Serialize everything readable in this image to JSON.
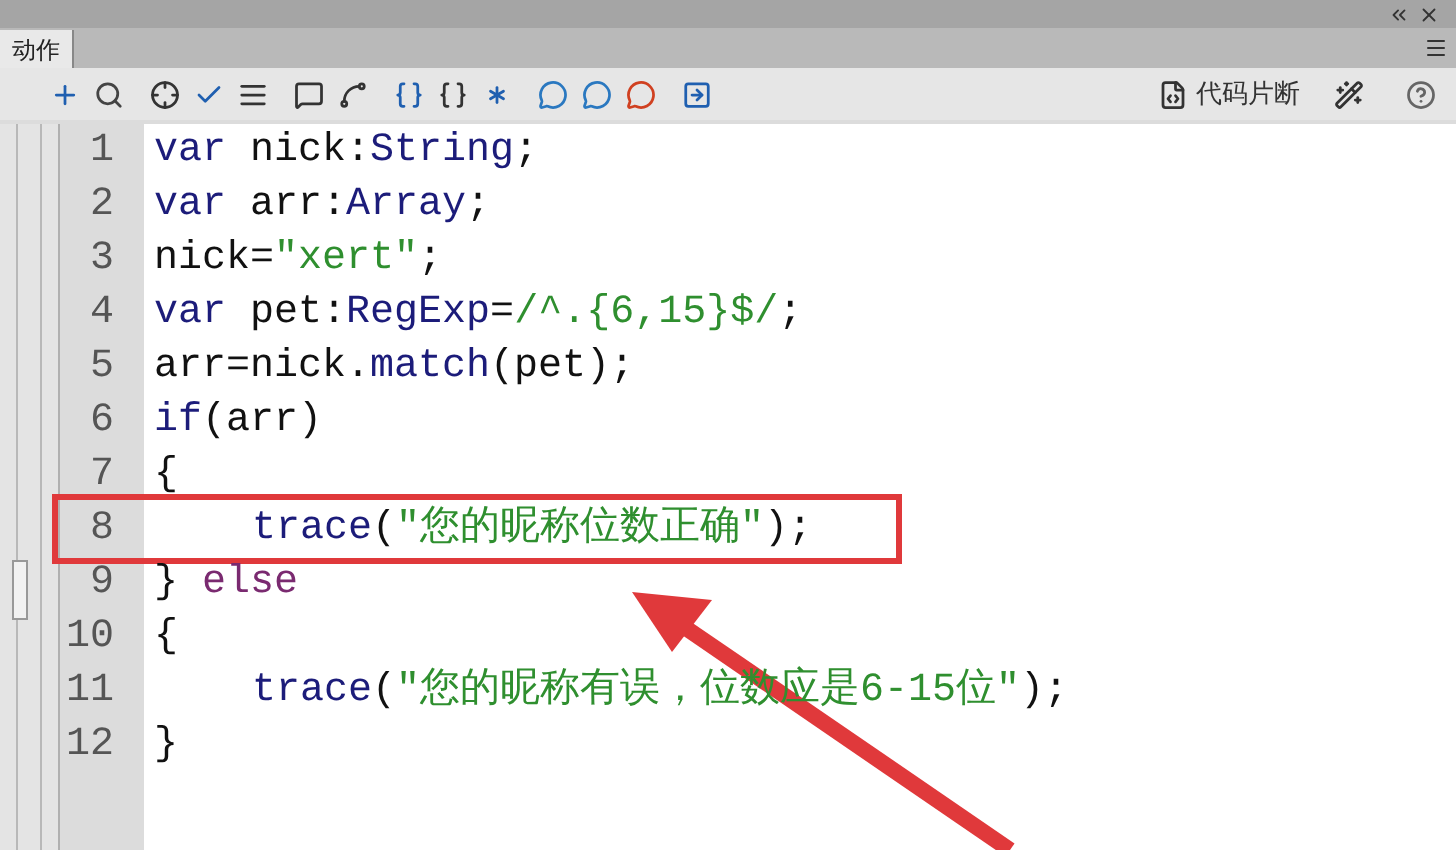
{
  "panel": {
    "tab": {
      "label": "动作",
      "selected": true
    },
    "toolbar": {
      "snippets_label": "代码片断"
    },
    "code_lines": [
      {
        "number": "1",
        "highlighted": false,
        "tokens": [
          {
            "kind": "keyword",
            "text": "var"
          },
          {
            "kind": "plain",
            "text": " nick:"
          },
          {
            "kind": "keyword",
            "text": "String"
          },
          {
            "kind": "plain",
            "text": ";"
          }
        ]
      },
      {
        "number": "2",
        "highlighted": false,
        "tokens": [
          {
            "kind": "keyword",
            "text": "var"
          },
          {
            "kind": "plain",
            "text": " arr:"
          },
          {
            "kind": "keyword",
            "text": "Array"
          },
          {
            "kind": "plain",
            "text": ";"
          }
        ]
      },
      {
        "number": "3",
        "highlighted": false,
        "tokens": [
          {
            "kind": "plain",
            "text": "nick="
          },
          {
            "kind": "string",
            "text": "\"xert\""
          },
          {
            "kind": "plain",
            "text": ";"
          }
        ]
      },
      {
        "number": "4",
        "highlighted": false,
        "tokens": [
          {
            "kind": "keyword",
            "text": "var"
          },
          {
            "kind": "plain",
            "text": " pet:"
          },
          {
            "kind": "keyword",
            "text": "RegExp"
          },
          {
            "kind": "plain",
            "text": "="
          },
          {
            "kind": "string",
            "text": "/^.{6,15}$/"
          },
          {
            "kind": "plain",
            "text": ";"
          }
        ]
      },
      {
        "number": "5",
        "highlighted": false,
        "tokens": [
          {
            "kind": "plain",
            "text": "arr=nick."
          },
          {
            "kind": "keyword",
            "text": "match"
          },
          {
            "kind": "plain",
            "text": "(pet);"
          }
        ]
      },
      {
        "number": "6",
        "highlighted": false,
        "tokens": [
          {
            "kind": "keyword",
            "text": "if"
          },
          {
            "kind": "plain",
            "text": "(arr)"
          }
        ]
      },
      {
        "number": "7",
        "highlighted": false,
        "tokens": [
          {
            "kind": "plain",
            "text": "{"
          }
        ],
        "children": [
          {
            "number": "8",
            "highlighted": true,
            "tokens": [
              {
                "kind": "keyword",
                "text": "trace"
              },
              {
                "kind": "plain",
                "text": "("
              },
              {
                "kind": "string",
                "text": "\"您的昵称位数正确\""
              },
              {
                "kind": "plain",
                "text": ");"
              }
            ]
          }
        ]
      },
      {
        "number": "9",
        "highlighted": false,
        "tokens": [
          {
            "kind": "plain",
            "text": "} "
          },
          {
            "kind": "builtin",
            "text": "else"
          }
        ]
      },
      {
        "number": "10",
        "highlighted": false,
        "tokens": [
          {
            "kind": "plain",
            "text": "{"
          }
        ],
        "children": [
          {
            "number": "11",
            "highlighted": false,
            "tokens": [
              {
                "kind": "keyword",
                "text": "trace"
              },
              {
                "kind": "plain",
                "text": "("
              },
              {
                "kind": "string",
                "text": "\"您的昵称有误，位数应是6-15位\""
              },
              {
                "kind": "plain",
                "text": ");"
              }
            ]
          }
        ]
      },
      {
        "number": "12",
        "highlighted": false,
        "tokens": [
          {
            "kind": "plain",
            "text": "}"
          }
        ]
      }
    ]
  }
}
